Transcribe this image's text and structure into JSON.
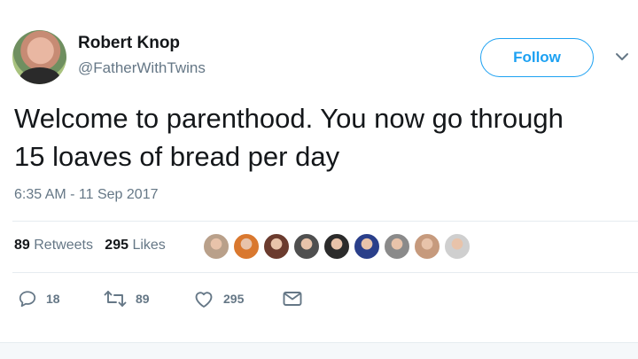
{
  "user": {
    "name": "Robert Knop",
    "handle": "@FatherWithTwins"
  },
  "follow_label": "Follow",
  "tweet": {
    "line1": "Welcome to parenthood. You now go through",
    "line2": "15 loaves of bread per day"
  },
  "timestamp": "6:35 AM - 11 Sep 2017",
  "stats": {
    "retweet_count": "89",
    "retweet_label": "Retweets",
    "like_count": "295",
    "like_label": "Likes"
  },
  "liker_avatars": [
    {
      "color": "#b9a08a"
    },
    {
      "color": "#d9782f"
    },
    {
      "color": "#6b3b2e"
    },
    {
      "color": "#4f4f4f"
    },
    {
      "color": "#2b2b2b"
    },
    {
      "color": "#2a3f8a"
    },
    {
      "color": "#8a8a8a"
    },
    {
      "color": "#c69a7d"
    },
    {
      "color": "#cfcfcf"
    }
  ],
  "actions": {
    "reply": {
      "icon": "reply-icon",
      "count": "18"
    },
    "retweet": {
      "icon": "retweet-icon",
      "count": "89"
    },
    "like": {
      "icon": "heart-icon",
      "count": "295"
    },
    "message": {
      "icon": "direct-message-icon"
    }
  },
  "colors": {
    "accent": "#1da1f2",
    "text": "#14171a",
    "secondary": "#657786",
    "divider": "#e6ecf0"
  }
}
